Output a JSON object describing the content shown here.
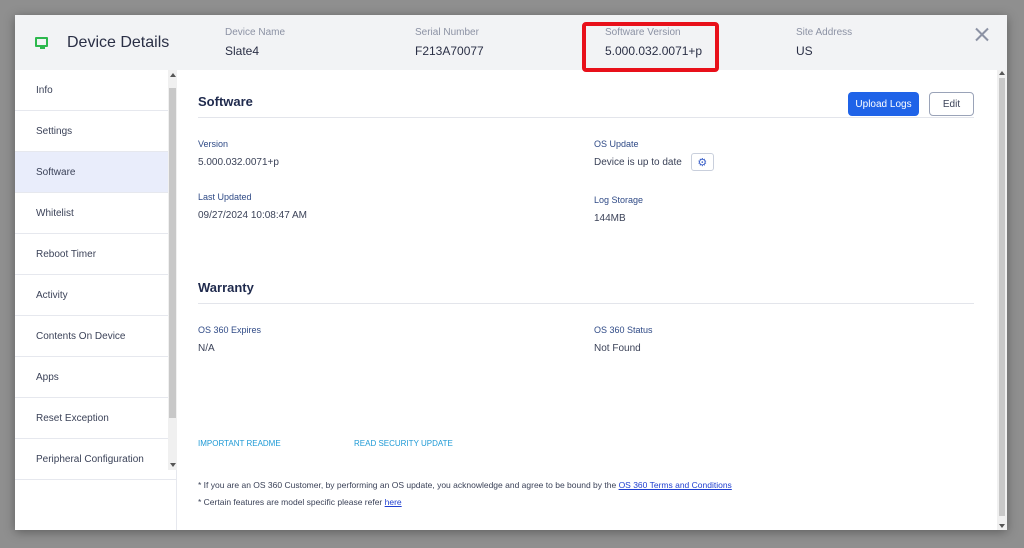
{
  "header": {
    "title": "Device Details",
    "fields": [
      {
        "label": "Device Name",
        "value": "Slate4"
      },
      {
        "label": "Serial Number",
        "value": "F213A70077"
      },
      {
        "label": "Software Version",
        "value": "5.000.032.0071+p"
      },
      {
        "label": "Site Address",
        "value": "US"
      }
    ],
    "highlight_color": "#e8101a",
    "device_icon": "monitor-icon",
    "device_icon_color": "#2db84d"
  },
  "sidebar": {
    "items": [
      {
        "label": "Info"
      },
      {
        "label": "Settings"
      },
      {
        "label": "Software",
        "active": true
      },
      {
        "label": "Whitelist"
      },
      {
        "label": "Reboot Timer"
      },
      {
        "label": "Activity"
      },
      {
        "label": "Contents On Device"
      },
      {
        "label": "Apps"
      },
      {
        "label": "Reset Exception"
      },
      {
        "label": "Peripheral Configuration"
      }
    ]
  },
  "software": {
    "title": "Software",
    "upload_logs_label": "Upload Logs",
    "edit_label": "Edit",
    "version_label": "Version",
    "version_value": "5.000.032.0071+p",
    "os_update_label": "OS Update",
    "os_update_value": "Device is up to date",
    "last_updated_label": "Last Updated",
    "last_updated_value": "09/27/2024 10:08:47 AM",
    "log_storage_label": "Log Storage",
    "log_storage_value": "144MB"
  },
  "warranty": {
    "title": "Warranty",
    "expires_label": "OS 360 Expires",
    "expires_value": "N/A",
    "status_label": "OS 360 Status",
    "status_value": "Not Found"
  },
  "links": {
    "readme": "IMPORTANT README",
    "security": "READ SECURITY UPDATE"
  },
  "notes": {
    "note1_prefix": "* If you are an OS 360 Customer, by performing an OS update, you acknowledge and agree to be bound by the",
    "note1_link": "OS 360 Terms and Conditions",
    "note2_prefix": "* Certain features are model specific please refer",
    "note2_link": "here"
  },
  "colors": {
    "primary_button": "#1f63e8",
    "active_sidebar": "#e9edfb",
    "link": "#1e9ad6"
  }
}
